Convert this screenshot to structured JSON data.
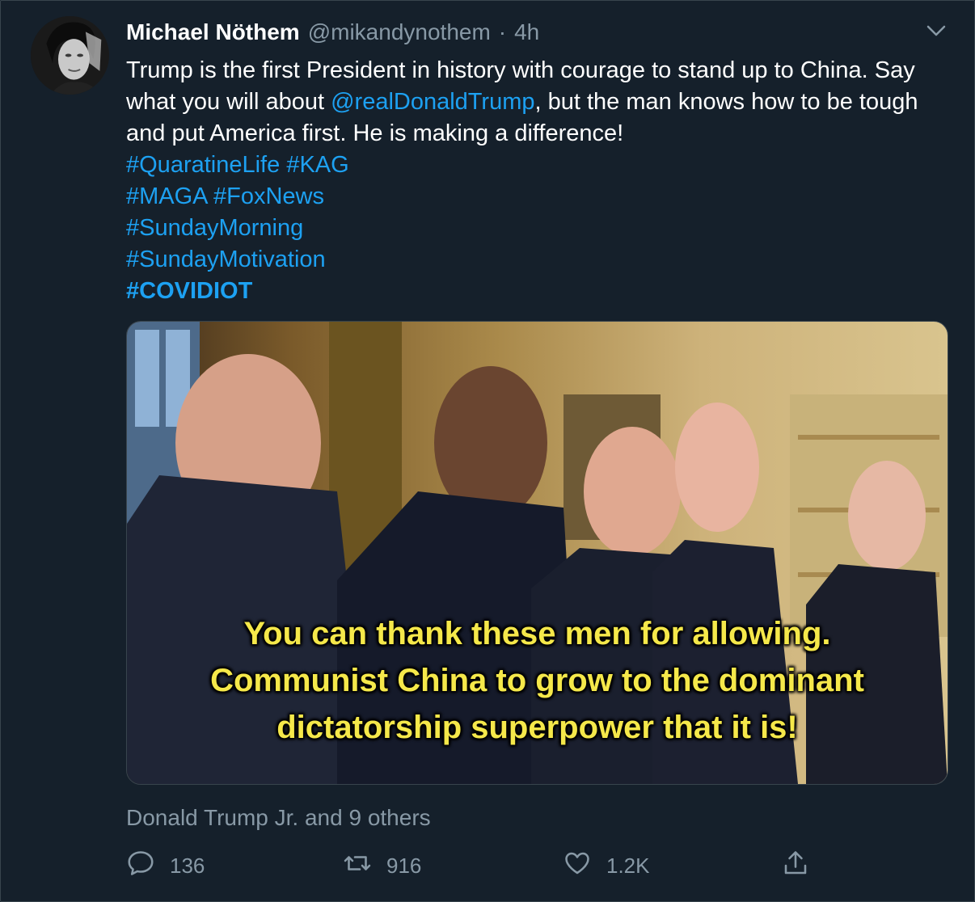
{
  "tweet": {
    "display_name": "Michael Nöthem",
    "handle": "@mikandynothem",
    "separator": "·",
    "time": "4h",
    "text_part1": "Trump is the first President in history with courage to stand up to China. Say what you will about ",
    "mention": "@realDonaldTrump",
    "text_part2": ", but the man knows how to be tough and put America first. He is making a difference!",
    "hashtags_line1": [
      "#QuaratineLife",
      "#KAG"
    ],
    "hashtags_line2": [
      "#MAGA",
      "#FoxNews"
    ],
    "hashtag_line3": "#SundayMorning",
    "hashtag_line4": "#SundayMotivation",
    "hashtag_bold": "#COVIDIOT",
    "media_caption_line1": "You can thank these men for allowing.",
    "media_caption_line2": "Communist China to grow to the dominant",
    "media_caption_line3": "dictatorship superpower that it is!",
    "liked_by": "Donald Trump Jr. and 9 others"
  },
  "actions": {
    "reply_count": "136",
    "retweet_count": "916",
    "like_count": "1.2K"
  },
  "icons": {
    "reply": "reply-icon",
    "retweet": "retweet-icon",
    "like": "heart-icon",
    "share": "share-icon",
    "more": "chevron-down-icon"
  },
  "colors": {
    "background": "#15202b",
    "link": "#1da1f2",
    "muted": "#8899a6",
    "caption": "#f5e84a"
  }
}
